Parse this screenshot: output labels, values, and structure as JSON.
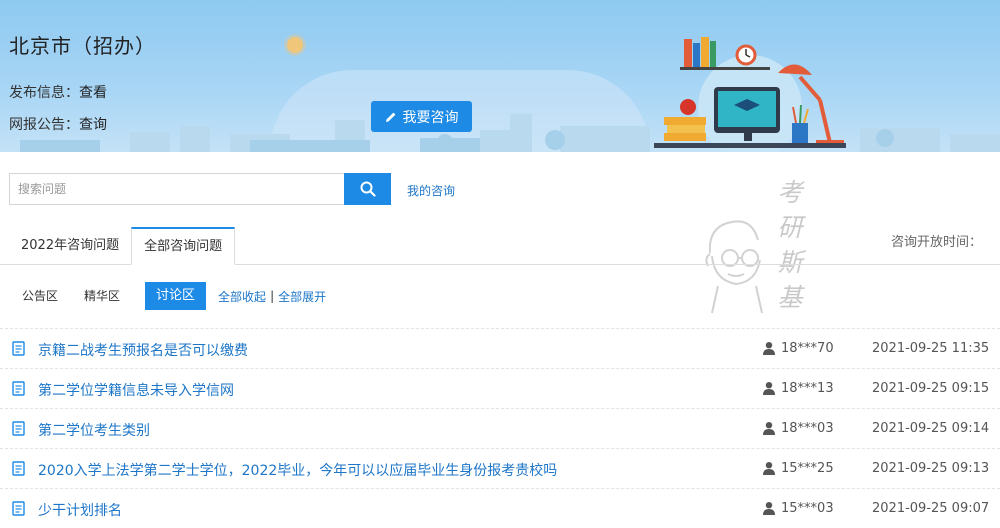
{
  "banner": {
    "city_title": "北京市（招办）",
    "publish_label": "发布信息：",
    "publish_link": "查看",
    "report_label": "网报公告：",
    "report_link": "查询",
    "consult_button": "我要咨询"
  },
  "search": {
    "placeholder": "搜索问题",
    "my_consult": "我的咨询"
  },
  "watermark": {
    "chars": [
      "考",
      "研",
      "斯",
      "基"
    ]
  },
  "tabs": [
    {
      "label": "2022年咨询问题",
      "active": false
    },
    {
      "label": "全部咨询问题",
      "active": true
    }
  ],
  "open_time_label": "咨询开放时间：",
  "subtabs": {
    "announce": "公告区",
    "featured": "精华区",
    "discuss": "讨论区",
    "collapse_all": "全部收起",
    "separator": "|",
    "expand_all": "全部展开"
  },
  "questions": [
    {
      "title": "京籍二战考生预报名是否可以缴费",
      "user": "18***70",
      "time": "2021-09-25 11:35"
    },
    {
      "title": "第二学位学籍信息未导入学信网",
      "user": "18***13",
      "time": "2021-09-25 09:15"
    },
    {
      "title": "第二学位考生类别",
      "user": "18***03",
      "time": "2021-09-25 09:14"
    },
    {
      "title": "2020入学上法学第二学士学位，2022毕业，今年可以以应届毕业生身份报考贵校吗",
      "user": "15***25",
      "time": "2021-09-25 09:13"
    },
    {
      "title": "少干计划排名",
      "user": "15***03",
      "time": "2021-09-25 09:07"
    }
  ],
  "colors": {
    "accent": "#1d8ae6",
    "link": "#1d76c8",
    "banner_sky": "#a9d6f5"
  }
}
